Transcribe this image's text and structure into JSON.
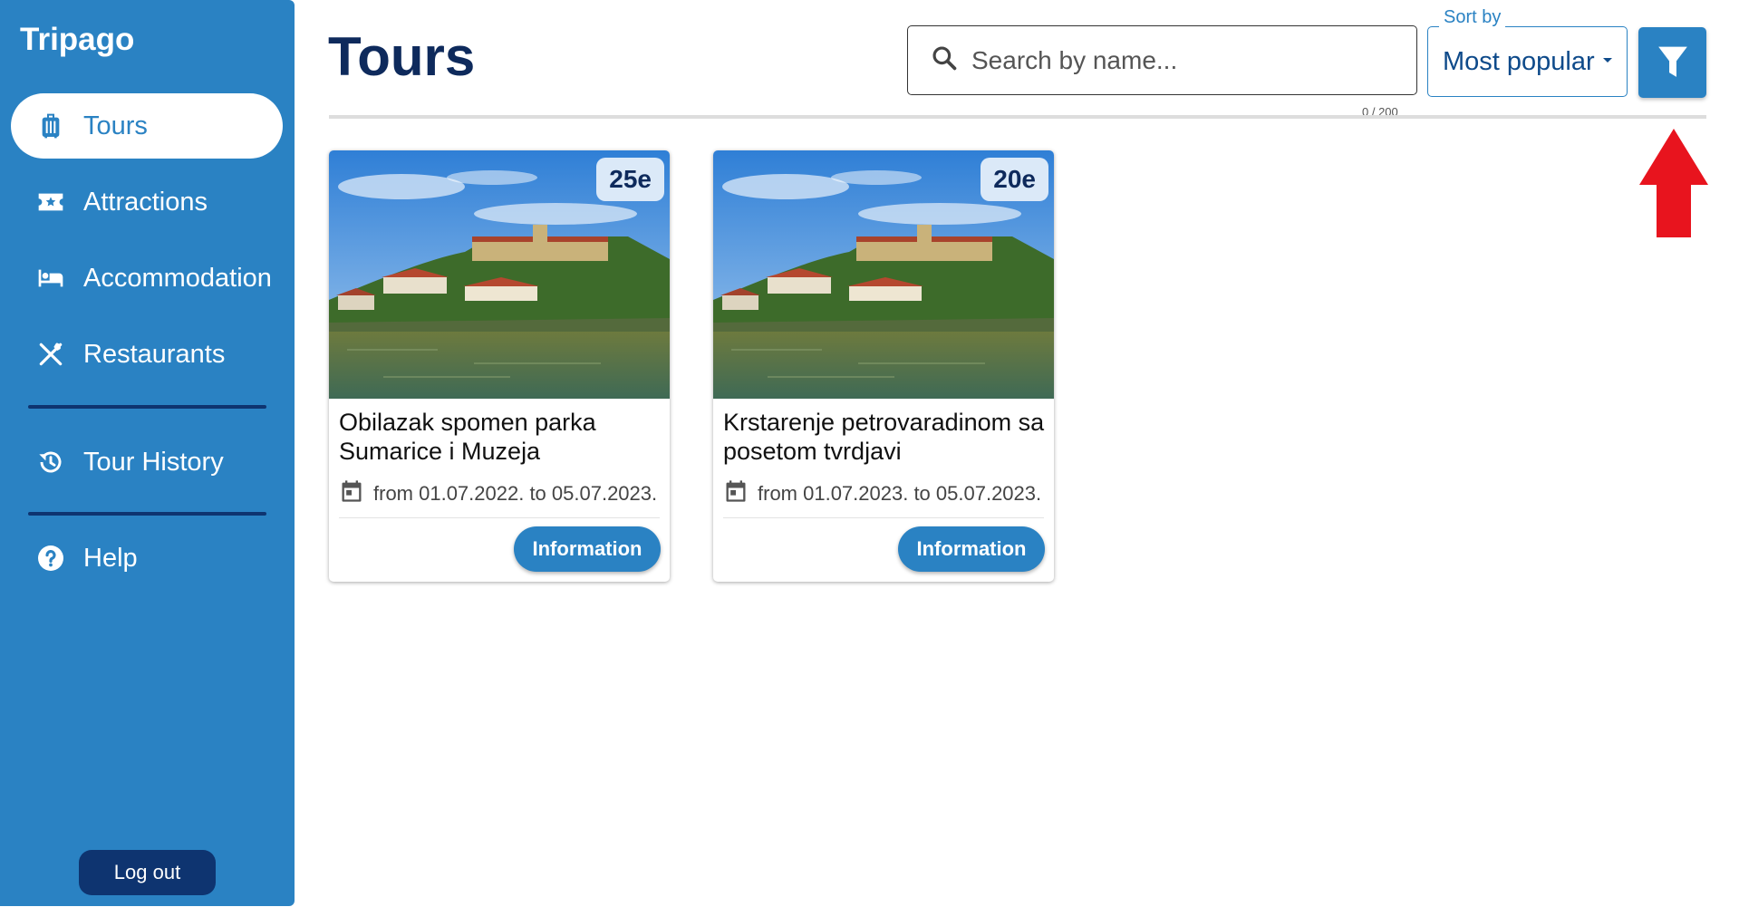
{
  "app": {
    "name": "Tripago"
  },
  "sidebar": {
    "items": [
      {
        "label": "Tours",
        "icon": "suitcase-icon",
        "active": true
      },
      {
        "label": "Attractions",
        "icon": "ticket-star-icon"
      },
      {
        "label": "Accommodation",
        "icon": "bed-icon"
      },
      {
        "label": "Restaurants",
        "icon": "cutlery-icon"
      },
      {
        "label": "Tour History",
        "icon": "history-icon"
      },
      {
        "label": "Help",
        "icon": "help-circle-icon"
      }
    ],
    "logout_label": "Log out"
  },
  "header": {
    "title": "Tours",
    "search": {
      "placeholder": "Search by name...",
      "value": "",
      "counter": "0 / 200"
    },
    "sort": {
      "label": "Sort by",
      "selected": "Most popular"
    },
    "filter_icon": "filter-icon"
  },
  "tours": [
    {
      "title": "Obilazak spomen parka Sumarice i Muzeja",
      "price": "25e",
      "dates": "from 01.07.2022. to 05.07.2023.",
      "button": "Information"
    },
    {
      "title": "Krstarenje petrovaradinom sa posetom tvrdjavi",
      "price": "20e",
      "dates": "from 01.07.2023. to 05.07.2023.",
      "button": "Information"
    }
  ],
  "colors": {
    "primary": "#2a82c3",
    "dark": "#0e3470",
    "title": "#0e2a5c",
    "annotation_arrow": "#e8141e"
  }
}
